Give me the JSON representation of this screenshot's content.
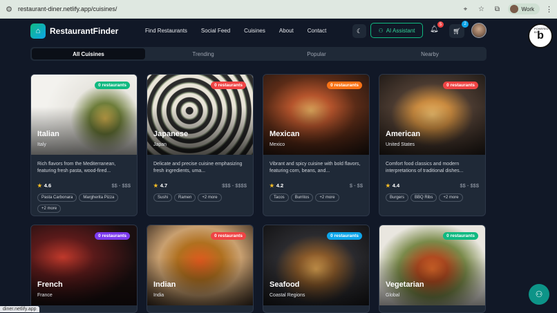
{
  "browser": {
    "url": "restaurant-diner.netlify.app/cuisines/",
    "profile_label": "Work",
    "status_url": "diner.netlify.app"
  },
  "header": {
    "brand": "RestaurantFinder",
    "nav": [
      "Find Restaurants",
      "Social Feed",
      "Cuisines",
      "About",
      "Contact"
    ],
    "ai_button": "AI Assistant",
    "notifications_count": "5",
    "cart_count": "2"
  },
  "tabs": [
    "All Cuisines",
    "Trending",
    "Popular",
    "Nearby"
  ],
  "cuisines": [
    {
      "name": "Italian",
      "region": "Italy",
      "badge": "0 restaurants",
      "badge_color": "#10b981",
      "desc": "Rich flavors from the Mediterranean, featuring fresh pasta, wood-fired...",
      "rating": "4.6",
      "price": "$$ - $$$",
      "tags": [
        "Pasta Carbonara",
        "Margherita Pizza",
        "+2 more"
      ]
    },
    {
      "name": "Japanese",
      "region": "Japan",
      "badge": "0 restaurants",
      "badge_color": "#ef4444",
      "desc": "Delicate and precise cuisine emphasizing fresh ingredients, uma...",
      "rating": "4.7",
      "price": "$$$ - $$$$",
      "tags": [
        "Sushi",
        "Ramen",
        "+2 more"
      ]
    },
    {
      "name": "Mexican",
      "region": "Mexico",
      "badge": "0 restaurants",
      "badge_color": "#f97316",
      "desc": "Vibrant and spicy cuisine with bold flavors, featuring corn, beans, and...",
      "rating": "4.2",
      "price": "$ - $$",
      "tags": [
        "Tacos",
        "Burritos",
        "+2 more"
      ]
    },
    {
      "name": "American",
      "region": "United States",
      "badge": "0 restaurants",
      "badge_color": "#ef4444",
      "desc": "Comfort food classics and modern interpretations of traditional dishes...",
      "rating": "4.4",
      "price": "$$ - $$$",
      "tags": [
        "Burgers",
        "BBQ Ribs",
        "+2 more"
      ]
    },
    {
      "name": "French",
      "region": "France",
      "badge": "0 restaurants",
      "badge_color": "#7c3aed"
    },
    {
      "name": "Indian",
      "region": "India",
      "badge": "0 restaurants",
      "badge_color": "#ef4444"
    },
    {
      "name": "Seafood",
      "region": "Coastal Regions",
      "badge": "0 restaurants",
      "badge_color": "#0ea5e9"
    },
    {
      "name": "Vegetarian",
      "region": "Global",
      "badge": "0 restaurants",
      "badge_color": "#10b981"
    }
  ]
}
